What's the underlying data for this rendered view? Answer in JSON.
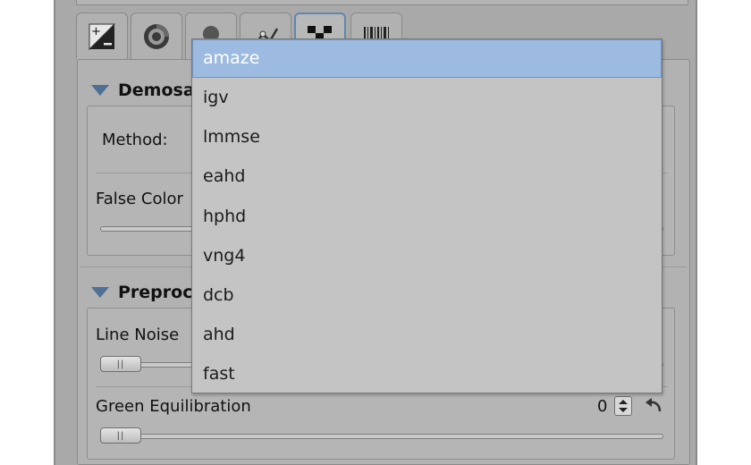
{
  "colors": {
    "accent": "#9dbbe0",
    "panel": "#b2b2b2",
    "section_triangle": "#4f6f94"
  },
  "tabs": [
    {
      "icon": "exposure-icon"
    },
    {
      "icon": "color-wheel-icon"
    },
    {
      "icon": "face-icon"
    },
    {
      "icon": "transform-icon"
    },
    {
      "icon": "raw-pattern-icon",
      "active": true
    },
    {
      "icon": "barcode-icon"
    }
  ],
  "demosaicing": {
    "title": "Demosa",
    "method_label": "Method:",
    "false_color_label": "False Color"
  },
  "preprocessing": {
    "title": "Preproc",
    "line_noise_label": "Line Noise",
    "green_eq_label": "Green Equilibration",
    "green_eq_value": "0",
    "green_eq_level": 0
  },
  "dropdown": {
    "selected": "amaze",
    "options": [
      "amaze",
      "igv",
      "lmmse",
      "eahd",
      "hphd",
      "vng4",
      "dcb",
      "ahd",
      "fast"
    ]
  }
}
